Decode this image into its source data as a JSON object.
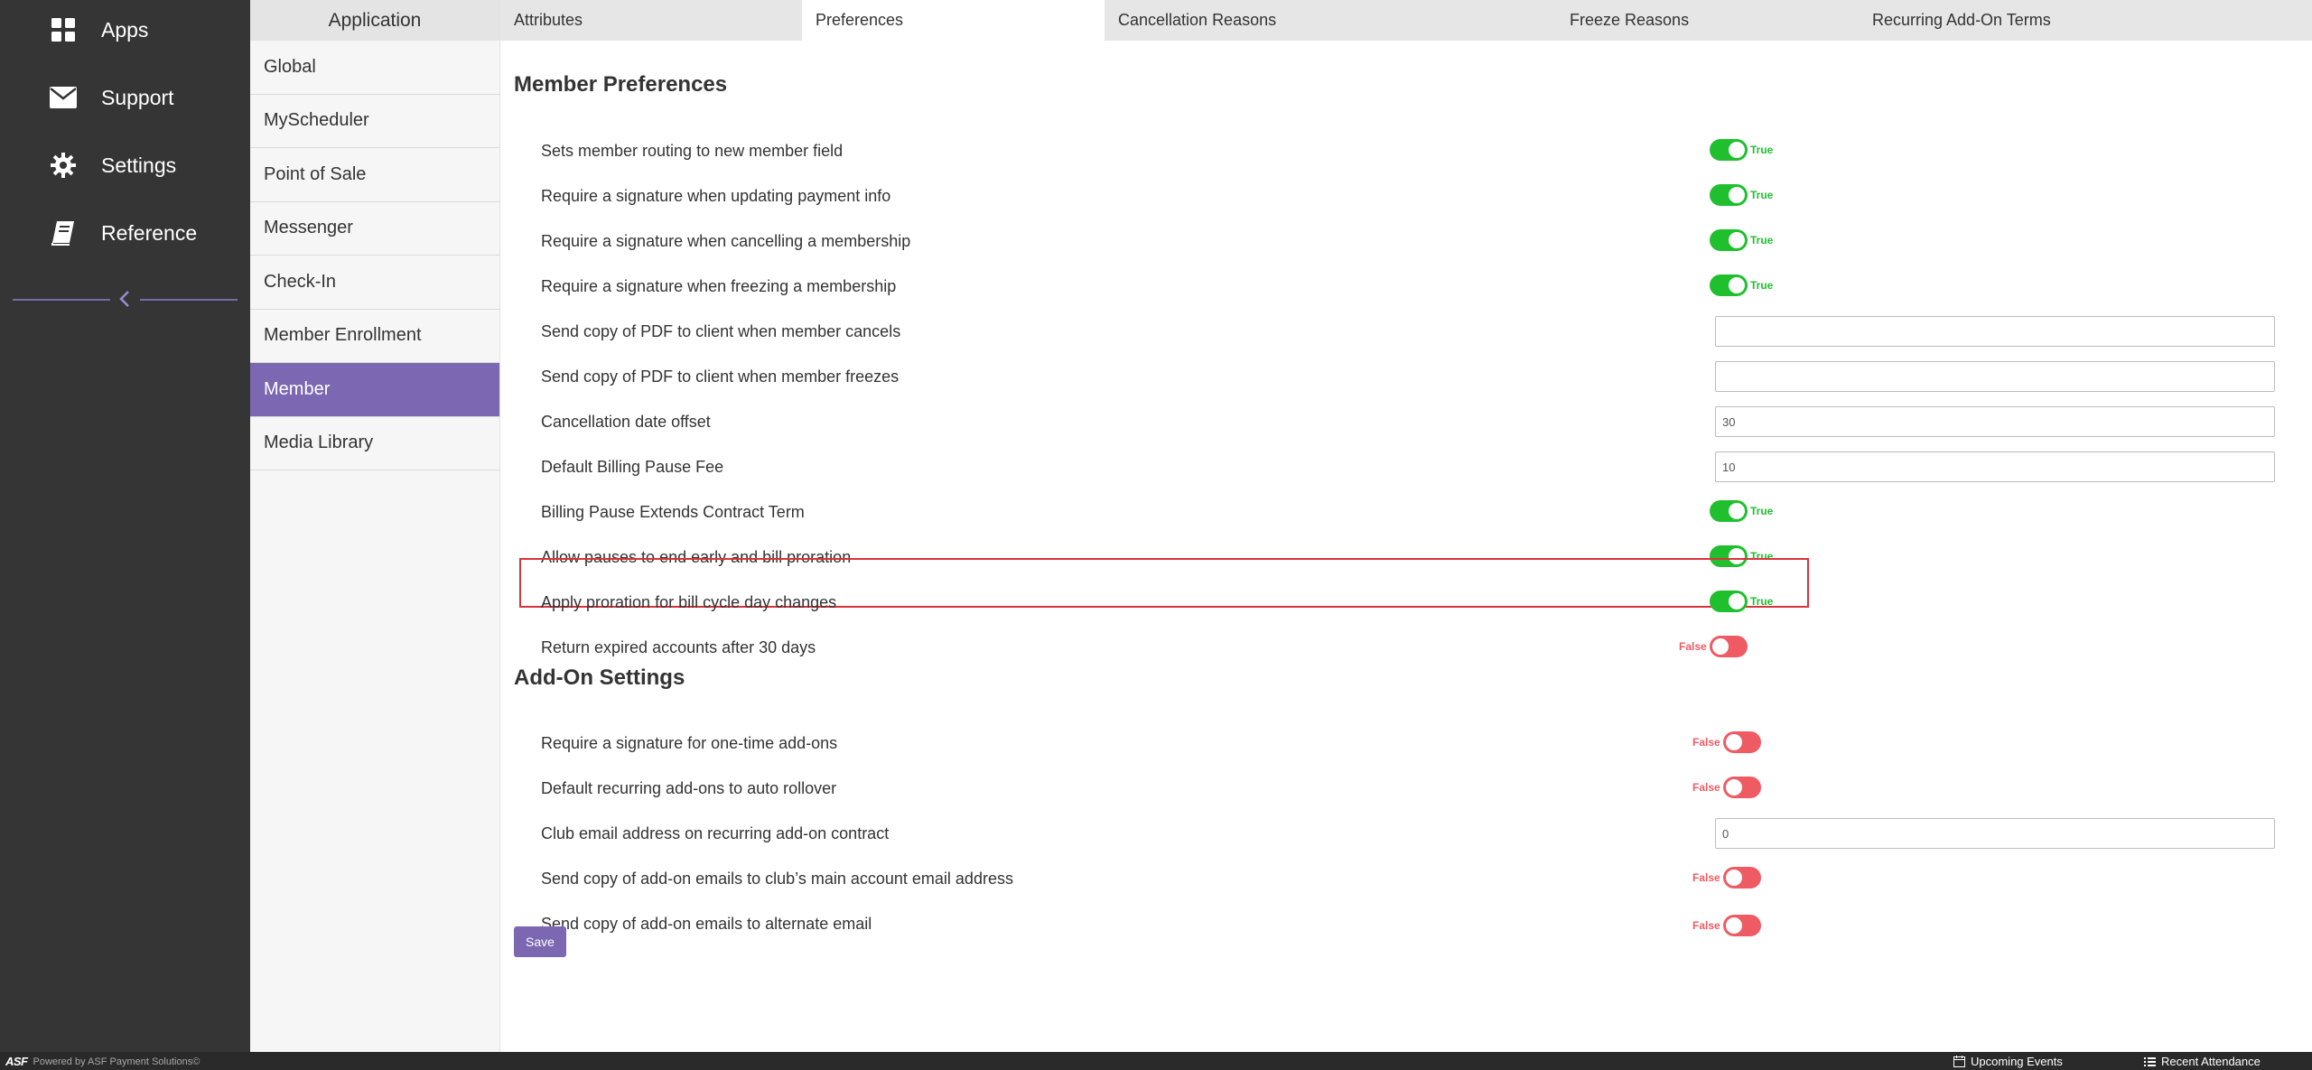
{
  "leftnav": {
    "items": [
      {
        "label": "Apps",
        "icon": "apps-grid-icon"
      },
      {
        "label": "Support",
        "icon": "envelope-icon"
      },
      {
        "label": "Settings",
        "icon": "gear-icon"
      },
      {
        "label": "Reference",
        "icon": "book-icon"
      }
    ],
    "accent": "#7a6aab"
  },
  "subnav": {
    "header": "Application",
    "items": [
      {
        "label": "Global"
      },
      {
        "label": "MyScheduler"
      },
      {
        "label": "Point of Sale"
      },
      {
        "label": "Messenger"
      },
      {
        "label": "Check-In"
      },
      {
        "label": "Member Enrollment"
      },
      {
        "label": "Member",
        "active": true
      },
      {
        "label": "Media Library"
      }
    ]
  },
  "tabs": [
    {
      "label": "Attributes"
    },
    {
      "label": "Preferences",
      "active": true
    },
    {
      "label": "Cancellation Reasons"
    },
    {
      "label": "Freeze Reasons"
    },
    {
      "label": "Recurring Add-On Terms"
    }
  ],
  "member_prefs": {
    "title": "Member Preferences",
    "rows": [
      {
        "label": "Sets member routing to new member field",
        "state": "True"
      },
      {
        "label": "Require a signature when updating payment info",
        "state": "True"
      },
      {
        "label": "Require a signature when cancelling a membership",
        "state": "True"
      },
      {
        "label": "Require a signature when freezing a membership",
        "state": "True"
      },
      {
        "label": "Send copy of PDF to client when member cancels",
        "value": ""
      },
      {
        "label": "Send copy of PDF to client when member freezes",
        "value": ""
      },
      {
        "label": "Cancellation date offset",
        "value": "30"
      },
      {
        "label": "Default Billing Pause Fee",
        "value": "10"
      },
      {
        "label": "Billing Pause Extends Contract Term",
        "state": "True"
      },
      {
        "label": "Allow pauses to end early and bill proration",
        "state": "True"
      },
      {
        "label": "Apply proration for bill cycle day changes",
        "state": "True"
      },
      {
        "label": "Return expired accounts after 30 days",
        "state": "False"
      }
    ]
  },
  "addon_settings": {
    "title": "Add-On Settings",
    "rows": [
      {
        "label": "Require a signature for one-time add-ons",
        "state": "False"
      },
      {
        "label": "Default recurring add-ons to auto rollover",
        "state": "False"
      },
      {
        "label": "Club email address on recurring add-on contract",
        "value": "0"
      },
      {
        "label": "Send copy of add-on emails to club’s main account email address",
        "state": "False"
      },
      {
        "label": "Send copy of add-on emails to alternate email",
        "state": "False"
      }
    ]
  },
  "save_label": "Save",
  "footer": {
    "logo": "ASF",
    "powered": "Powered by ASF Payment Solutions©",
    "upcoming": "Upcoming Events",
    "recent": "Recent Attendance"
  },
  "colors": {
    "toggle_on": "#1fbf2e",
    "toggle_off": "#ee5b63",
    "brand_purple": "#7b67b2",
    "highlight": "#d9333a"
  }
}
